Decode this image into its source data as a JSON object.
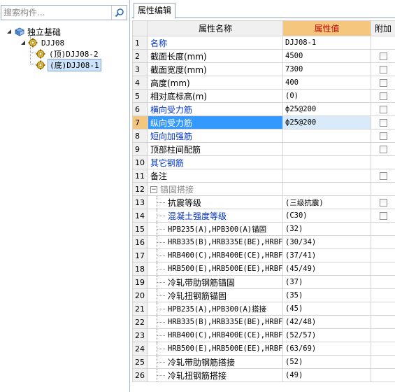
{
  "search": {
    "placeholder": "搜索构件..."
  },
  "tree": {
    "root_label": "独立基础",
    "parent_label": "DJJ08",
    "children": [
      "(顶)DJJ08-2",
      "(底)DJJ08-1"
    ]
  },
  "tab": {
    "label": "属性编辑"
  },
  "grid": {
    "headers": {
      "name": "属性名称",
      "value": "属性值",
      "add": "附加"
    },
    "rows": [
      {
        "num": "1",
        "name": "名称",
        "value": "DJJ08-1",
        "checkbox": false
      },
      {
        "num": "2",
        "name": "截面长度(mm)",
        "value": "4500",
        "checkbox": true
      },
      {
        "num": "3",
        "name": "截面宽度(mm)",
        "value": "7300",
        "checkbox": true
      },
      {
        "num": "4",
        "name": "高度(mm)",
        "value": "400",
        "checkbox": true
      },
      {
        "num": "5",
        "name": "相对底标高(m)",
        "value": "(0)",
        "checkbox": true
      },
      {
        "num": "6",
        "name": "横向受力筋",
        "value": "ф25@200",
        "checkbox": true
      },
      {
        "num": "7",
        "name": "纵向受力筋",
        "value": "ф25@200",
        "checkbox": true
      },
      {
        "num": "8",
        "name": "短向加强筋",
        "value": "",
        "checkbox": true
      },
      {
        "num": "9",
        "name": "顶部柱间配筋",
        "value": "",
        "checkbox": true
      },
      {
        "num": "10",
        "name": "其它钢筋",
        "value": "",
        "checkbox": false
      },
      {
        "num": "11",
        "name": "备注",
        "value": "",
        "checkbox": true
      },
      {
        "num": "12",
        "name": "锚固搭接",
        "value": "",
        "checkbox": false
      },
      {
        "num": "13",
        "name": "抗震等级",
        "value": "(三级抗震)",
        "checkbox": true
      },
      {
        "num": "14",
        "name": "混凝土强度等级",
        "value": "(C30)",
        "checkbox": true
      },
      {
        "num": "15",
        "name": "HPB235(A),HPB300(A)锚固",
        "value": "(32)",
        "checkbox": false
      },
      {
        "num": "16",
        "name": "HRB335(B),HRB335E(BE),HRBF",
        "value": "(30/34)",
        "checkbox": false
      },
      {
        "num": "17",
        "name": "HRB400(C),HRB400E(CE),HRBF",
        "value": "(37/41)",
        "checkbox": false
      },
      {
        "num": "18",
        "name": "HRB500(E),HRB500E(EE),HRBF",
        "value": "(45/49)",
        "checkbox": false
      },
      {
        "num": "19",
        "name": "冷轧带肋钢筋锚固",
        "value": "(37)",
        "checkbox": false
      },
      {
        "num": "20",
        "name": "冷轧扭钢筋锚固",
        "value": "(35)",
        "checkbox": false
      },
      {
        "num": "21",
        "name": "HPB235(A),HPB300(A)搭接",
        "value": "(45)",
        "checkbox": false
      },
      {
        "num": "22",
        "name": "HRB335(B),HRB335E(BE),HRBF",
        "value": "(42/48)",
        "checkbox": false
      },
      {
        "num": "23",
        "name": "HRB400(C),HRB400E(CE),HRBF",
        "value": "(52/57)",
        "checkbox": false
      },
      {
        "num": "24",
        "name": "HRB500(E),HRB500E(EE),HRBF",
        "value": "(63/69)",
        "checkbox": false
      },
      {
        "num": "25",
        "name": "冷轧带肋钢筋搭接",
        "value": "(52)",
        "checkbox": false
      },
      {
        "num": "26",
        "name": "冷轧扭钢筋搭接",
        "value": "(49)",
        "checkbox": false
      }
    ]
  },
  "colors": {
    "link_blue": "#0033cc",
    "value_header_bg": "#f5c77e",
    "value_header_text": "#c00000",
    "selection_blue": "#3399ff"
  },
  "icons": {
    "search": "search-icon",
    "tree_root": "component-icon",
    "tree_node": "gear-icon"
  }
}
